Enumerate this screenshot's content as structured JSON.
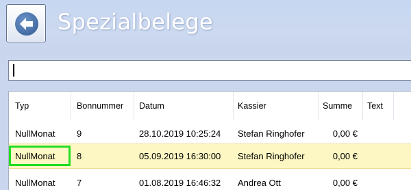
{
  "header": {
    "title": "Spezialbelege",
    "back_icon": "back-arrow-icon"
  },
  "search": {
    "value": ""
  },
  "table": {
    "columns": [
      "Typ",
      "Bonnummer",
      "Datum",
      "Kassier",
      "Summe",
      "Text"
    ],
    "rows": [
      {
        "typ": "NullMonat",
        "bonnummer": "9",
        "datum": "28.10.2019 10:25:24",
        "kassier": "Stefan Ringhofer",
        "summe": "0,00 €",
        "text": ""
      },
      {
        "typ": "NullMonat",
        "bonnummer": "8",
        "datum": "05.09.2019 16:30:00",
        "kassier": "Stefan Ringhofer",
        "summe": "0,00 €",
        "text": "",
        "selected": true
      },
      {
        "typ": "NullMonat",
        "bonnummer": "7",
        "datum": "01.08.2019 16:46:32",
        "kassier": "Andrea Ott",
        "summe": "0,00 €",
        "text": ""
      }
    ]
  },
  "colors": {
    "header_bg": "#c9d6ee",
    "selected_row_bg": "#fdf7c3",
    "highlight_border": "#22dd22",
    "back_icon": "#4f77ad"
  }
}
